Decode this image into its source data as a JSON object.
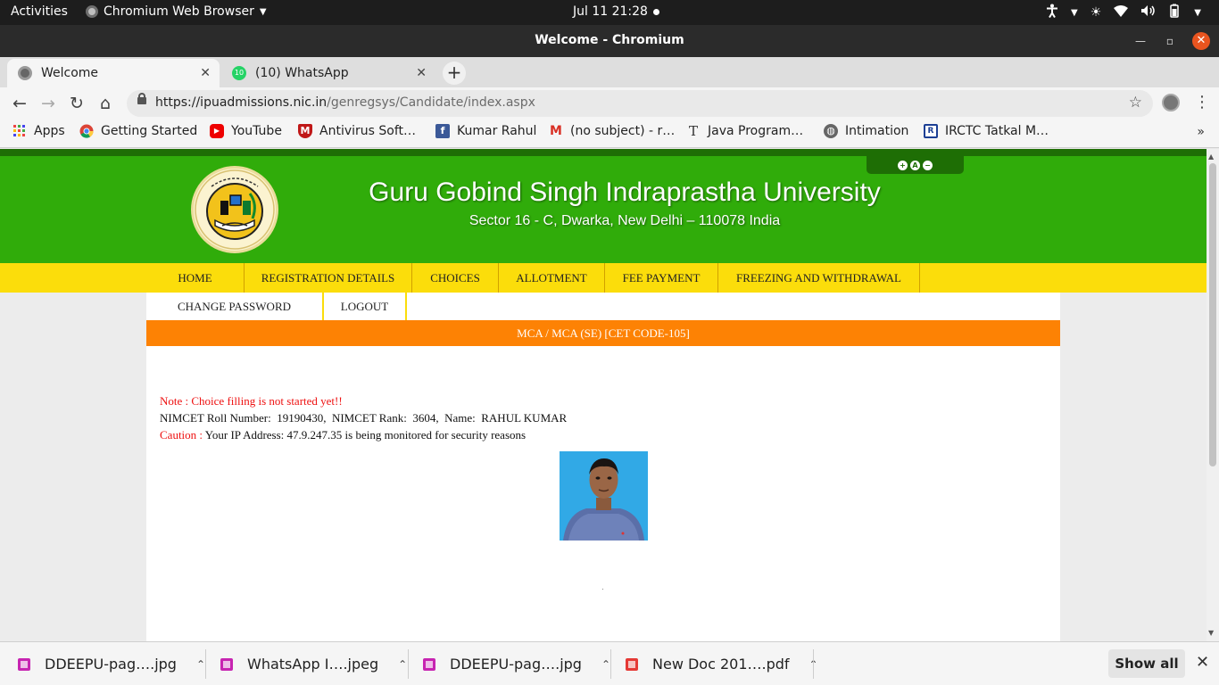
{
  "system_bar": {
    "activities": "Activities",
    "app_name": "Chromium Web Browser",
    "clock": "Jul 11  21:28"
  },
  "window": {
    "title": "Welcome - Chromium"
  },
  "tabs": [
    {
      "title": "Welcome",
      "active": true
    },
    {
      "title": "(10) WhatsApp",
      "active": false,
      "badge": "10"
    }
  ],
  "address_bar": {
    "url_host": "https://ipuadmissions.nic.in",
    "url_path": "/genregsys/Candidate/index.aspx"
  },
  "bookmarks": [
    {
      "label": "Apps",
      "icon": "apps-grid-icon"
    },
    {
      "label": "Getting Started",
      "icon": "chrome-icon"
    },
    {
      "label": "YouTube",
      "icon": "youtube-icon"
    },
    {
      "label": "Antivirus Soft…",
      "icon": "mcafee-icon"
    },
    {
      "label": "Kumar Rahul",
      "icon": "facebook-icon"
    },
    {
      "label": "(no subject) - r…",
      "icon": "gmail-icon"
    },
    {
      "label": "Java Program…",
      "icon": "text-icon"
    },
    {
      "label": "Intimation",
      "icon": "globe-icon"
    },
    {
      "label": "IRCTC Tatkal M…",
      "icon": "irctc-icon"
    }
  ],
  "site": {
    "university_name": "Guru Gobind Singh Indraprastha University",
    "address": "Sector 16 - C, Dwarka, New Delhi – 110078 India",
    "accessibility": [
      "+",
      "A",
      "−"
    ],
    "menu_primary": [
      "HOME",
      "REGISTRATION DETAILS",
      "CHOICES",
      "ALLOTMENT",
      "FEE PAYMENT",
      "FREEZING AND WITHDRAWAL"
    ],
    "menu_secondary": [
      "CHANGE PASSWORD",
      "LOGOUT"
    ],
    "course_title": "MCA / MCA (SE) [CET CODE-105]",
    "note": "Note : Choice filling is not started yet!!",
    "candidate_line": "NIMCET Roll Number:  19190430,  NIMCET Rank:  3604,  Name:  RAHUL KUMAR",
    "caution_label": "Caution : ",
    "caution_text": "Your IP Address: 47.9.247.35 is being monitored for security reasons",
    "colors": {
      "header_green": "#30ac0a",
      "menu_yellow": "#fbdd0b",
      "course_orange": "#fd8204"
    }
  },
  "downloads": [
    {
      "name": "DDEEPU-pag….jpg",
      "type": "image"
    },
    {
      "name": "WhatsApp I….jpeg",
      "type": "image"
    },
    {
      "name": "DDEEPU-pag….jpg",
      "type": "image"
    },
    {
      "name": "New Doc 201….pdf",
      "type": "pdf"
    }
  ],
  "download_shelf": {
    "show_all": "Show all"
  }
}
